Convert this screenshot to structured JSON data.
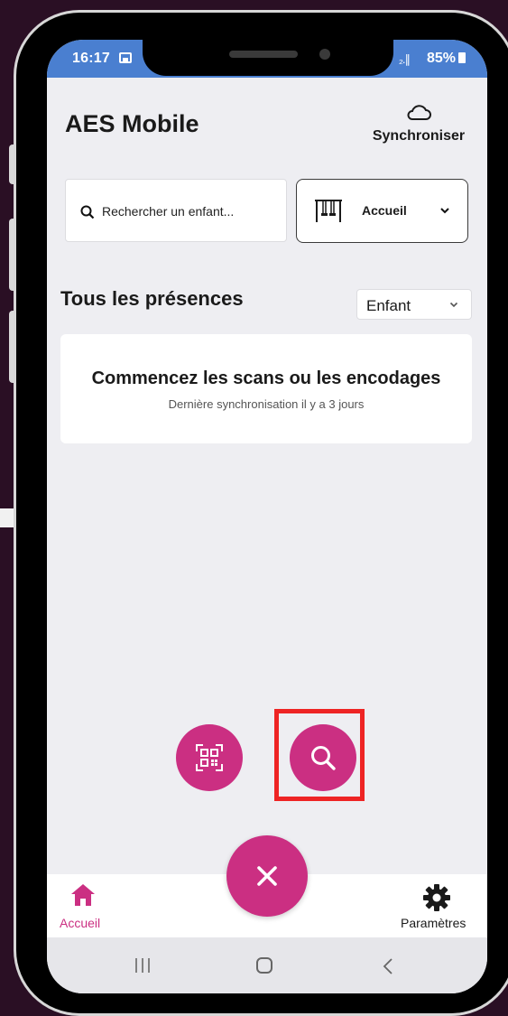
{
  "status_bar": {
    "time": "16:17",
    "signal": "₂.∥",
    "battery": "85%"
  },
  "header": {
    "title": "AES Mobile",
    "sync_label": "Synchroniser"
  },
  "search": {
    "placeholder": "Rechercher un enfant..."
  },
  "location": {
    "selected": "Accueil"
  },
  "presences": {
    "title": "Tous les présences",
    "filter_selected": "Enfant"
  },
  "empty_state": {
    "title": "Commencez les scans ou les encodages",
    "subtitle": "Dernière synchronisation il y a 3 jours"
  },
  "bottom_nav": {
    "home_label": "Accueil",
    "settings_label": "Paramètres"
  },
  "colors": {
    "accent": "#cb2f82",
    "status_bar": "#4a7fd0",
    "highlight": "#ee2424"
  },
  "icons": [
    "image-icon",
    "battery-icon",
    "cloud-icon",
    "search-icon",
    "swing-icon",
    "chevron-down-icon",
    "qr-code-icon",
    "close-icon",
    "home-icon",
    "gear-icon"
  ]
}
